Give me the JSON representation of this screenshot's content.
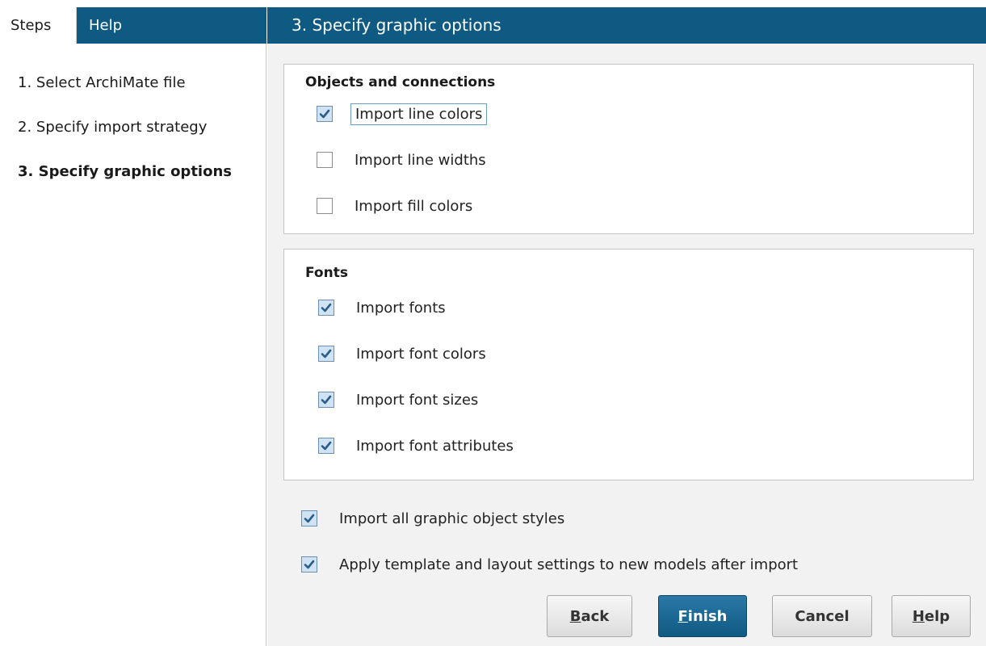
{
  "left_tabs": {
    "steps": "Steps",
    "help": "Help"
  },
  "steps": [
    {
      "label": "1. Select ArchiMate file",
      "active": false
    },
    {
      "label": "2. Specify import strategy",
      "active": false
    },
    {
      "label": "3. Specify graphic options",
      "active": true
    }
  ],
  "title": "3. Specify graphic options",
  "objects_group": {
    "title": "Objects and connections",
    "options": [
      {
        "label": "Import line colors",
        "checked": true,
        "focused": true
      },
      {
        "label": "Import line widths",
        "checked": false
      },
      {
        "label": "Import fill colors",
        "checked": false
      }
    ]
  },
  "fonts_group": {
    "title": "Fonts",
    "options": [
      {
        "label": "Import fonts",
        "checked": true
      },
      {
        "label": "Import font colors",
        "checked": true
      },
      {
        "label": "Import font sizes",
        "checked": true
      },
      {
        "label": "Import font attributes",
        "checked": true
      }
    ]
  },
  "extra_options": [
    {
      "label": "Import all graphic object styles",
      "checked": true
    },
    {
      "label": "Apply template and layout settings to new models after import",
      "checked": true
    }
  ],
  "buttons": {
    "back": {
      "mnemonic": "B",
      "rest": "ack"
    },
    "finish": {
      "mnemonic": "F",
      "rest": "inish"
    },
    "cancel": {
      "label": "Cancel"
    },
    "help": {
      "mnemonic": "H",
      "rest": "elp"
    }
  },
  "colors": {
    "accent": "#0f5a82",
    "panel": "#f2f2f2"
  }
}
